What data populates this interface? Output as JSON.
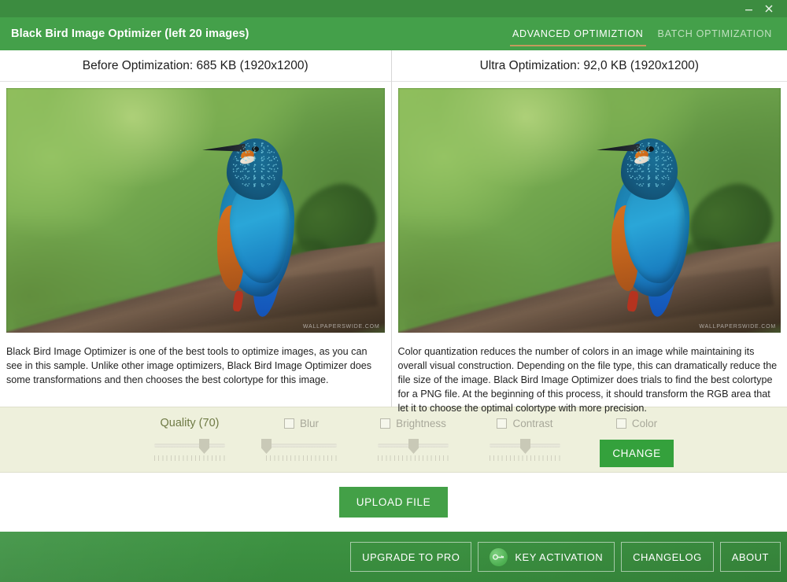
{
  "window": {
    "minimize_label": "minimize-icon",
    "close_label": "close-icon"
  },
  "header": {
    "title": "Black Bird Image Optimizer (left 20 images)",
    "accent_green": "#44a04a",
    "titlebar_green": "#3c8c40",
    "tab_underline": "#c49a5c",
    "tabs": [
      {
        "label": "ADVANCED OPTIMIZTION",
        "active": true
      },
      {
        "label": "BATCH OPTIMIZATION",
        "active": false
      }
    ]
  },
  "panes": {
    "left": {
      "title": "Before Optimization: 685 KB (1920x1200)",
      "image_alt": "kingfisher-photo",
      "watermark": "WALLPAPERSWIDE.COM",
      "description": "Black Bird Image Optimizer is one of the best tools to optimize images, as you can see in this sample. Unlike other image optimizers, Black Bird Image Optimizer does some transformations and then chooses the best colortype for this image."
    },
    "right": {
      "title": "Ultra Optimization: 92,0 KB (1920x1200)",
      "image_alt": "kingfisher-photo-optimized",
      "watermark": "WALLPAPERSWIDE.COM",
      "description": "Color quantization reduces the number of colors in an image while maintaining its overall visual construction. Depending on the file type, this can dramatically reduce the file size of the image. Black Bird Image Optimizer does trials to find the best colortype for a PNG file. At the beginning of this process, it should transform the RGB area that let it to choose the optimal colortype with more precision."
    }
  },
  "controls": {
    "background": "#eef0dc",
    "items": [
      {
        "label": "Quality (70)",
        "has_checkbox": false,
        "checked": false,
        "enabled": true,
        "value": 70
      },
      {
        "label": "Blur",
        "has_checkbox": true,
        "checked": false,
        "enabled": false,
        "value": 0
      },
      {
        "label": "Brightness",
        "has_checkbox": true,
        "checked": false,
        "enabled": false,
        "value": 50
      },
      {
        "label": "Contrast",
        "has_checkbox": true,
        "checked": false,
        "enabled": false,
        "value": 50
      },
      {
        "label": "Color",
        "has_checkbox": true,
        "checked": false,
        "enabled": false,
        "value": null
      }
    ],
    "change_label": "CHANGE",
    "change_color": "#34a13c"
  },
  "upload": {
    "label": "UPLOAD FILE",
    "color": "#43a047"
  },
  "footer": {
    "buttons": [
      {
        "label": "UPGRADE TO PRO",
        "icon": null
      },
      {
        "label": "KEY ACTIVATION",
        "icon": "key-icon"
      },
      {
        "label": "CHANGELOG",
        "icon": null
      },
      {
        "label": "ABOUT",
        "icon": null
      }
    ]
  }
}
